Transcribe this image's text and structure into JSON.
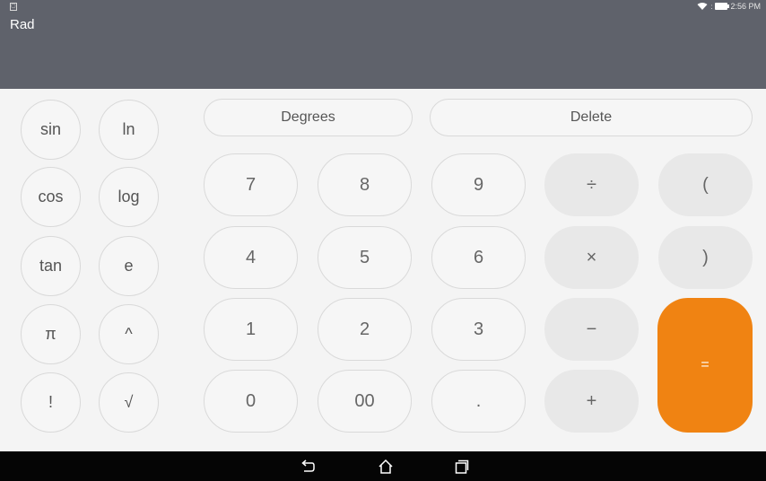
{
  "status_bar": {
    "notification_icon": "notification-icon",
    "wifi_icon": "wifi-icon",
    "signal_indicator": ":",
    "battery_icon": "battery-icon",
    "time": "2:56 PM"
  },
  "display": {
    "angle_mode": "Rad",
    "expression": ""
  },
  "scientific": {
    "sin": "sin",
    "ln": "ln",
    "cos": "cos",
    "log": "log",
    "tan": "tan",
    "e": "e",
    "pi": "π",
    "power": "^",
    "factorial": "!",
    "sqrt": "√"
  },
  "controls": {
    "degrees": "Degrees",
    "delete": "Delete"
  },
  "digits": {
    "seven": "7",
    "eight": "8",
    "nine": "9",
    "four": "4",
    "five": "5",
    "six": "6",
    "one": "1",
    "two": "2",
    "three": "3",
    "zero": "0",
    "double_zero": "00",
    "decimal": "."
  },
  "operators": {
    "divide": "÷",
    "multiply": "×",
    "minus": "−",
    "plus": "+",
    "open_paren": "(",
    "close_paren": ")",
    "equals": "="
  },
  "colors": {
    "display_bg": "#5f626b",
    "keypad_bg": "#f4f4f4",
    "accent": "#f08312"
  },
  "nav_bar": {
    "back_icon": "back-icon",
    "home_icon": "home-icon",
    "recents_icon": "recents-icon"
  }
}
